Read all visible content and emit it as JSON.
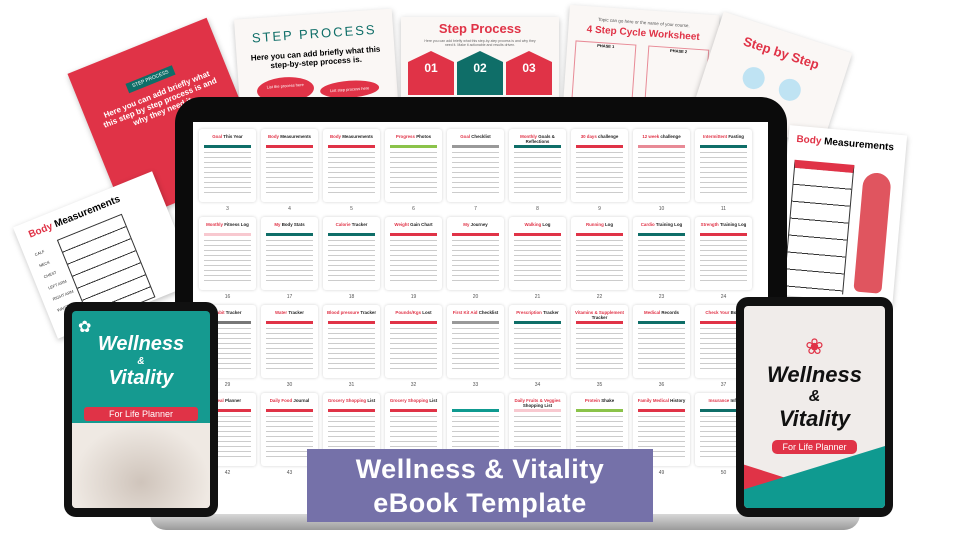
{
  "colors": {
    "accent_red": "#e03347",
    "accent_teal": "#0f6e68",
    "banner": "#7571a9"
  },
  "background_sheets": {
    "red_card": {
      "badge": "STEP PROCESS",
      "text": "Here you can add briefly what this step by step process is and why they need it."
    },
    "step_process_1": {
      "title": "STEP PROCESS",
      "subtitle": "Here you can add briefly what this step-by-step process is.",
      "bubble1": "List the process here",
      "bubble2": "List step process here"
    },
    "step_process_2": {
      "title": "Step Process",
      "text": "Here you can add briefly what this step-by-step process is and why they need it. Make it actionable and results driven.",
      "steps": [
        "01",
        "02",
        "03"
      ]
    },
    "cycle_worksheet": {
      "topic": "Topic can go here or the name of your course.",
      "title": "4 Step Cycle Worksheet",
      "phase1": "PHASE 1",
      "phase2": "PHASE 2"
    },
    "step_by_step": {
      "title": "Step by Step"
    },
    "body_measurements_right": {
      "title_red": "Body",
      "title_black": "Measurements"
    },
    "body_measurements_left": {
      "title_red": "Body",
      "title_black": "Measurements",
      "rows": [
        "CALF",
        "NECK",
        "CHEST",
        "LEFT ARM",
        "RIGHT ARM",
        "WAIST"
      ]
    }
  },
  "pages": [
    {
      "red": "Goal",
      "black": "This Year",
      "num": "3",
      "accent": "#0f6e68"
    },
    {
      "red": "Body",
      "black": "Measurements",
      "num": "4",
      "accent": "#e03347"
    },
    {
      "red": "Body",
      "black": "Measurements",
      "num": "5",
      "accent": "#e03347"
    },
    {
      "red": "Progress",
      "black": "Photos",
      "num": "6",
      "accent": "#8bc34a"
    },
    {
      "red": "Goal",
      "black": "Checklist",
      "num": "7",
      "accent": "#999999"
    },
    {
      "red": "Monthly",
      "black": "Goals & Reflections",
      "num": "8",
      "accent": "#0f6e68"
    },
    {
      "red": "30 days",
      "black": "challenge",
      "num": "9",
      "accent": "#e03347"
    },
    {
      "red": "12 week",
      "black": "challenge",
      "num": "10",
      "accent": "#e88a96"
    },
    {
      "red": "Intermittent",
      "black": "Fasting",
      "num": "11",
      "accent": "#0f6e68"
    },
    {
      "red": "Monthly",
      "black": "Fitness Log",
      "num": "16",
      "accent": "#f8c9d0"
    },
    {
      "red": "My",
      "black": "Body Stats",
      "num": "17",
      "accent": "#0f6e68"
    },
    {
      "red": "Calorie",
      "black": "Tracker",
      "num": "18",
      "accent": "#0f6e68"
    },
    {
      "red": "Weight",
      "black": "Gain Chart",
      "num": "19",
      "accent": "#e03347"
    },
    {
      "red": "My",
      "black": "Journey",
      "num": "20",
      "accent": "#e03347"
    },
    {
      "red": "Walking",
      "black": "Log",
      "num": "21",
      "accent": "#e03347"
    },
    {
      "red": "Running",
      "black": "Log",
      "num": "22",
      "accent": "#e03347"
    },
    {
      "red": "Cardio",
      "black": "Training Log",
      "num": "23",
      "accent": "#0f6e68"
    },
    {
      "red": "Strength",
      "black": "Training Log",
      "num": "24",
      "accent": "#e03347"
    },
    {
      "red": "Habit",
      "black": "Tracker",
      "num": "29",
      "accent": "#777777"
    },
    {
      "red": "Water",
      "black": "Tracker",
      "num": "30",
      "accent": "#e03347"
    },
    {
      "red": "Blood pressure",
      "black": "Tracker",
      "num": "31",
      "accent": "#e03347"
    },
    {
      "red": "Pounds/Kgs",
      "black": "Lost",
      "num": "32",
      "accent": "#e03347"
    },
    {
      "red": "First Kit Aid",
      "black": "Checklist",
      "num": "33",
      "accent": "#999999"
    },
    {
      "red": "Prescription",
      "black": "Tracker",
      "num": "34",
      "accent": "#0f6e68"
    },
    {
      "red": "Vitamins & Supplement",
      "black": "Tracker",
      "num": "35",
      "accent": "#e03347"
    },
    {
      "red": "Medical",
      "black": "Records",
      "num": "36",
      "accent": "#0f6e68"
    },
    {
      "red": "Check Your",
      "black": "Body",
      "num": "37",
      "accent": "#e03347"
    },
    {
      "red": "Meal",
      "black": "Planner",
      "num": "42",
      "accent": "#e03347"
    },
    {
      "red": "Daily Food",
      "black": "Journal",
      "num": "43",
      "accent": "#e03347"
    },
    {
      "red": "Grocery Shopping",
      "black": "List",
      "num": "",
      "accent": "#e03347"
    },
    {
      "red": "Grocery Shopping",
      "black": "List",
      "num": "",
      "accent": "#e03347"
    },
    {
      "red": "",
      "black": "",
      "num": "",
      "accent": "#0f9a90"
    },
    {
      "red": "Daily Fruits & Veggies",
      "black": "Shopping List",
      "num": "",
      "accent": "#f8c9d0"
    },
    {
      "red": "Protein",
      "black": "Shake",
      "num": "",
      "accent": "#8bc34a"
    },
    {
      "red": "Family Medical",
      "black": "History",
      "num": "49",
      "accent": "#e03347"
    },
    {
      "red": "Insurance",
      "black": "Info",
      "num": "50",
      "accent": "#0f6e68"
    }
  ],
  "left_tablet": {
    "title1": "Wellness",
    "amp": "&",
    "title2": "Vitality",
    "tagline": "For Life Planner"
  },
  "right_tablet": {
    "title1": "Wellness",
    "amp": "&",
    "title2": "Vitality",
    "tagline": "For Life Planner"
  },
  "banner": {
    "line1": "Wellness & Vitality",
    "line2": "eBook Template"
  }
}
